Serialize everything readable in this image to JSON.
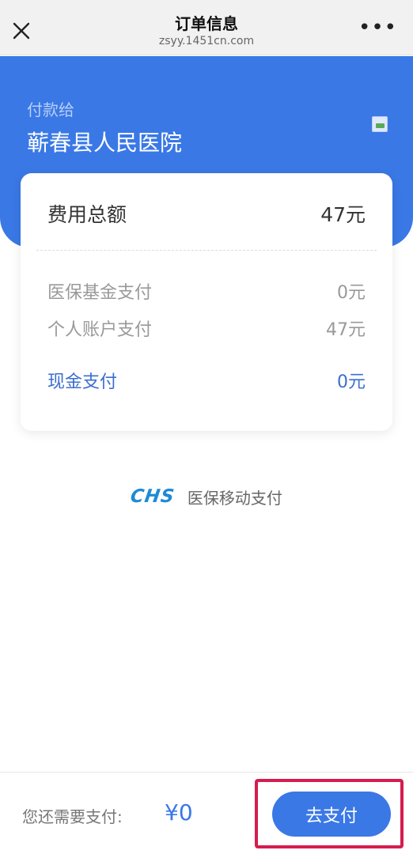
{
  "nav": {
    "title": "订单信息",
    "url": "zsyy.1451cn.com",
    "more": "•••"
  },
  "header": {
    "pay_to_label": "付款给",
    "hospital_name": "蕲春县人民医院"
  },
  "card": {
    "total_label": "费用总额",
    "total_value": "47元",
    "fund_label": "医保基金支付",
    "fund_value": "0元",
    "personal_label": "个人账户支付",
    "personal_value": "47元",
    "cash_label": "现金支付",
    "cash_value": "0元"
  },
  "brand": {
    "logo_text": "CHS",
    "text": "医保移动支付"
  },
  "bottom": {
    "remaining_label": "您还需要支付:",
    "remaining_amount": "¥0",
    "pay_button": "去支付"
  },
  "colors": {
    "primary": "#3a78e6",
    "highlight": "#d61c4e",
    "brand": "#1e8ad6"
  },
  "icons": [
    "close-icon",
    "more-icon",
    "hospital-logo-icon",
    "chs-logo"
  ]
}
